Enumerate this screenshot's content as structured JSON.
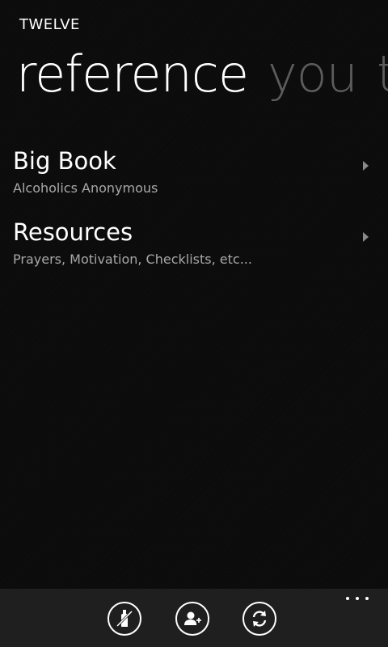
{
  "app": {
    "title": "TWELVE"
  },
  "pivot": {
    "items": [
      {
        "label": "reference"
      },
      {
        "label": "you"
      },
      {
        "label": "t"
      }
    ]
  },
  "list": {
    "items": [
      {
        "title": "Big Book",
        "subtitle": "Alcoholics Anonymous"
      },
      {
        "title": "Resources",
        "subtitle": "Prayers, Motivation, Checklists, etc..."
      }
    ]
  },
  "app_bar": {
    "buttons": [
      {
        "icon": "no-drinking-bottle-icon"
      },
      {
        "icon": "add-contact-icon"
      },
      {
        "icon": "sync-icon"
      }
    ],
    "more_icon": "more-ellipsis-icon"
  },
  "colors": {
    "background": "#0b0b0b",
    "text": "#ffffff",
    "secondary_text": "#a8a8a8",
    "inactive_pivot": "#5c5c5c",
    "app_bar": "#1f1f1f"
  }
}
